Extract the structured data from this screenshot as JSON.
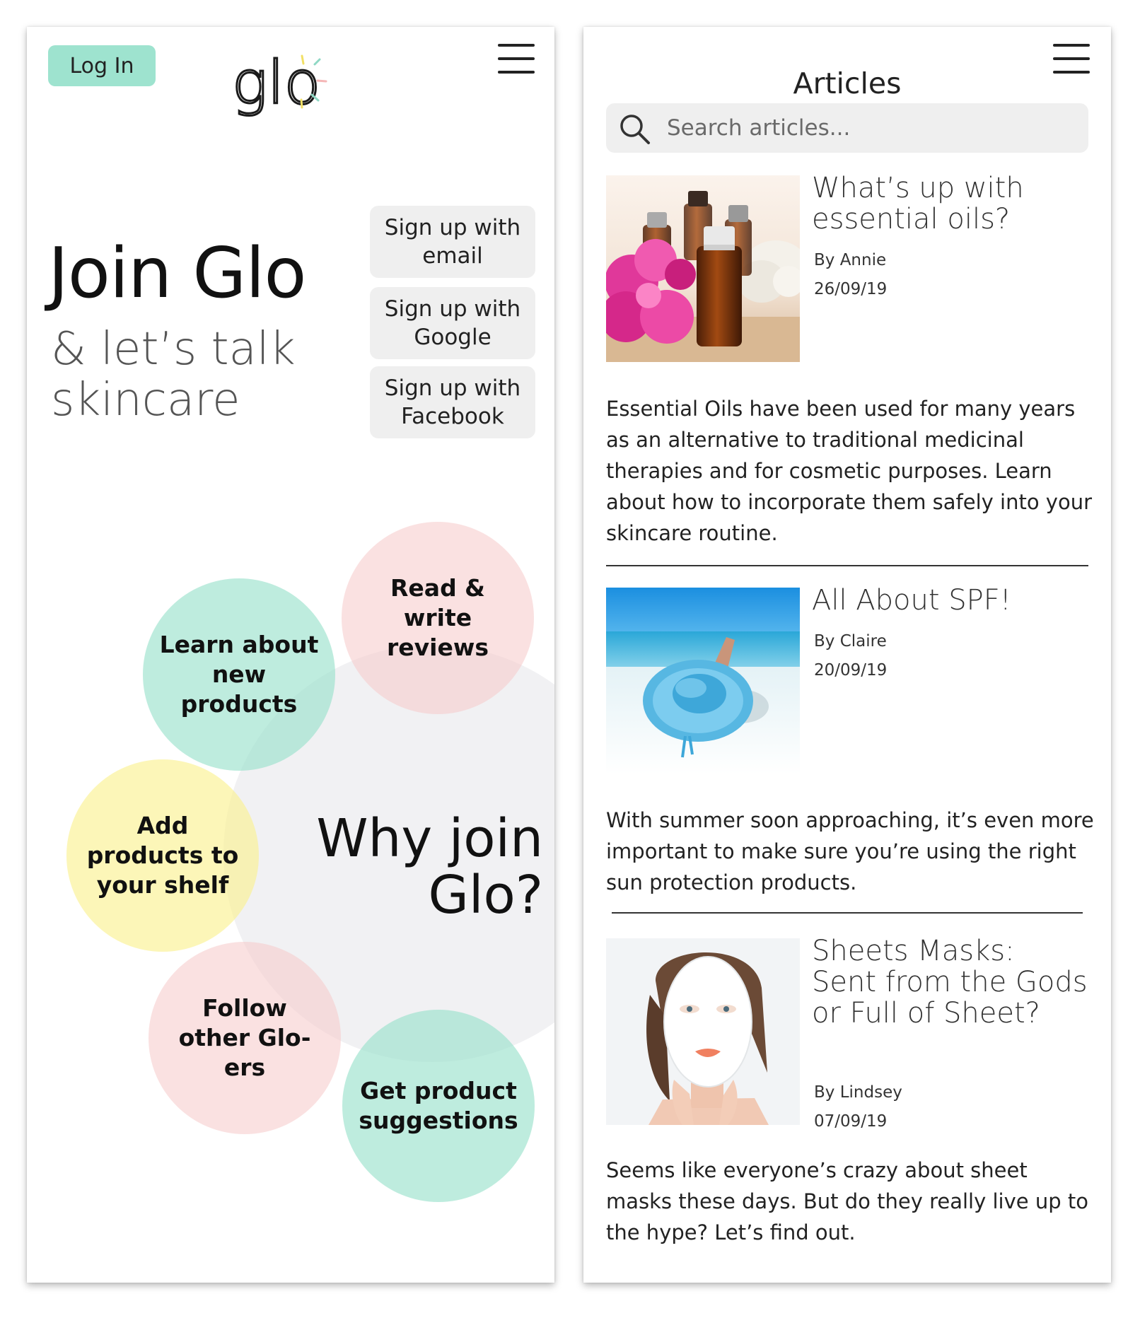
{
  "left_screen": {
    "login_label": "Log In",
    "logo_text": "glo",
    "headline": "Join Glo",
    "subheadline": "& let’s talk skincare",
    "signup_buttons": [
      {
        "label": "Sign up with email"
      },
      {
        "label": "Sign up with Google"
      },
      {
        "label": "Sign up with Facebook"
      }
    ],
    "why_title": "Why join Glo?",
    "features": [
      {
        "label": "Read & write reviews",
        "color": "pink"
      },
      {
        "label": "Learn about new products",
        "color": "teal"
      },
      {
        "label": "Add products to your shelf",
        "color": "yellow"
      },
      {
        "label": "Follow other Glo-ers",
        "color": "pink"
      },
      {
        "label": "Get product suggestions",
        "color": "teal"
      }
    ]
  },
  "right_screen": {
    "title": "Articles",
    "search": {
      "placeholder": "Search articles..."
    },
    "articles": [
      {
        "title": "What’s up with essential oils?",
        "author": "By Annie",
        "date": "26/09/19",
        "excerpt": "Essential Oils have been used for many years as an alternative to traditional medicinal therapies and for cosmetic purposes. Learn about how to incorporate them safely into your skincare routine.",
        "image": "essential-oil-bottles-with-flowers"
      },
      {
        "title": "All About SPF!",
        "author": "By Claire",
        "date": "20/09/19",
        "excerpt": "With summer soon approaching, it’s even more important to make sure you’re using the right sun protection products.",
        "image": "person-in-blue-sun-hat-on-beach"
      },
      {
        "title": "Sheets Masks: Sent from the Gods or Full of Sheet?",
        "author": "By Lindsey",
        "date": "07/09/19",
        "excerpt": "Seems like everyone’s crazy about sheet masks these days. But do they really live up to the hype? Let’s find out.",
        "image": "woman-wearing-sheet-mask"
      }
    ]
  },
  "colors": {
    "accent_teal": "#9ee3cf",
    "bubble_teal": "#96e1ca",
    "bubble_pink": "#f6cccc",
    "bubble_yellow": "#faf08c",
    "button_gray": "#efefef",
    "text_dark": "#1a1a1a"
  }
}
